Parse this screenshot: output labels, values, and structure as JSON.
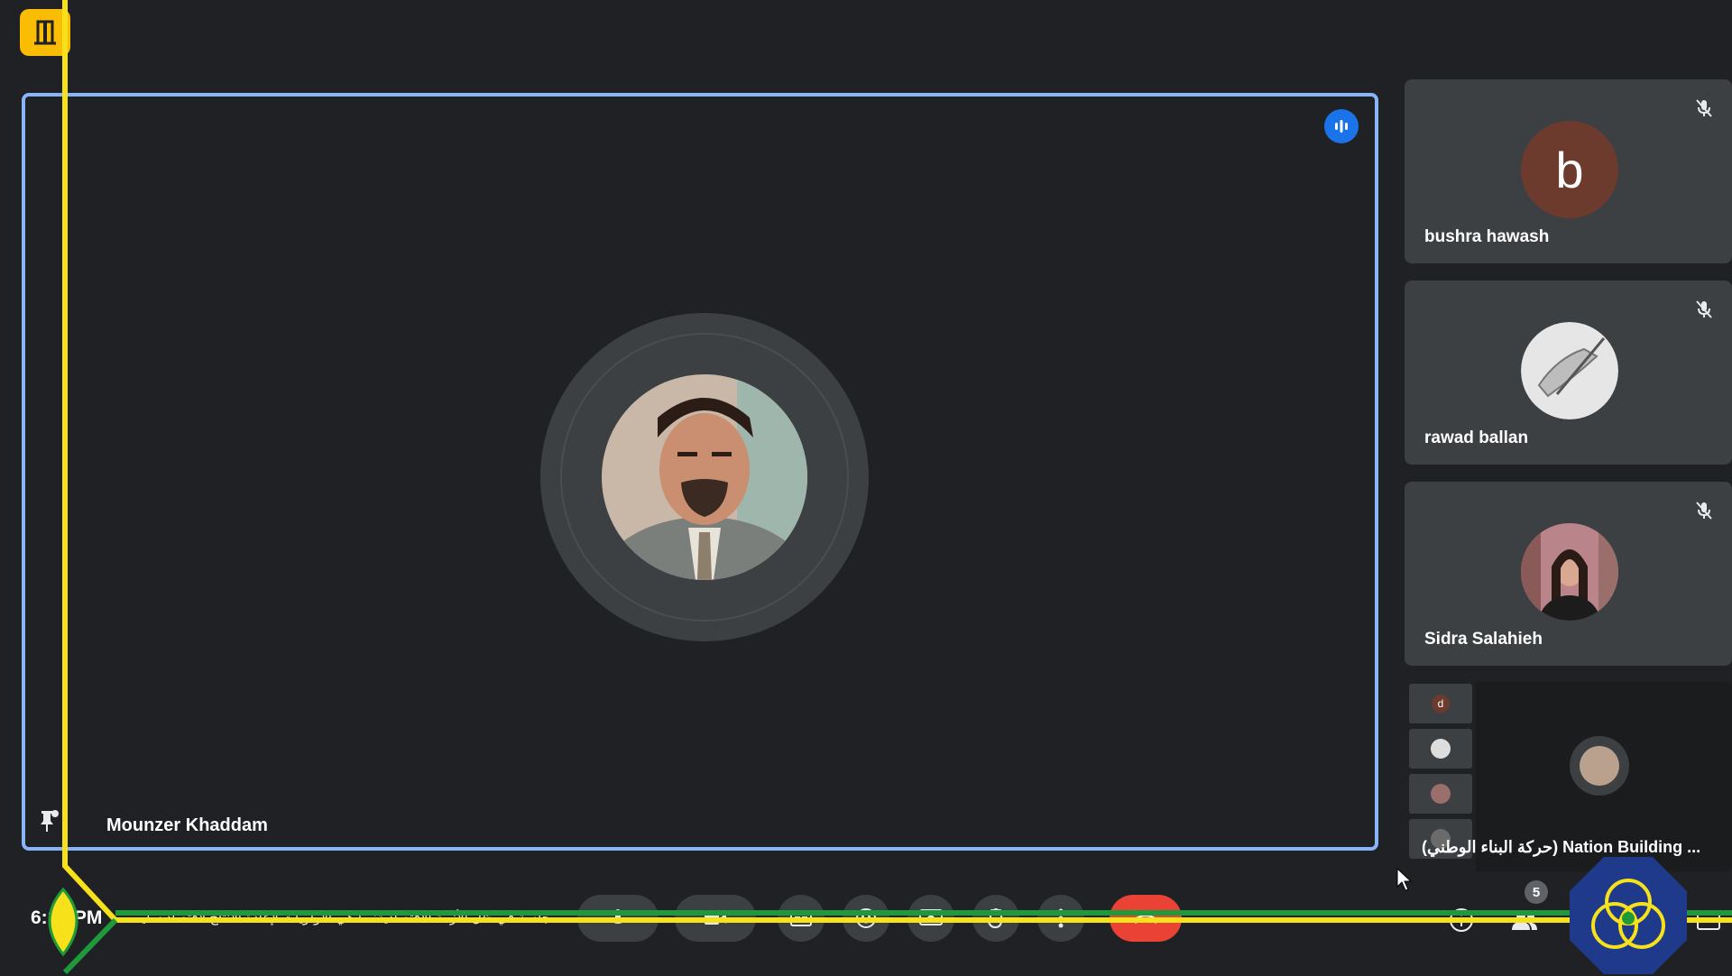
{
  "main_speaker": {
    "name": "Mounzer Khaddam"
  },
  "side_participants": [
    {
      "name": "bushra hawash",
      "avatar_letter": "b",
      "muted": true
    },
    {
      "name": "rawad ballan",
      "muted": true
    },
    {
      "name": "Sidra Salahieh",
      "muted": true
    }
  ],
  "mini_grid": {
    "label": "(حركة البناء الوطني) Nation Building ...",
    "thumb_letter": "d"
  },
  "footer": {
    "clock": "6:19 PM",
    "ticker": "جلسة في ظل الأزمة الاقتصادية: ما هي الاولويات لإعادة الانتاج لاقتصاد سليم في سوريا",
    "participant_count": "5"
  },
  "colors": {
    "active_border": "#8ab4f8",
    "end_call": "#ea4335",
    "speaking": "#1a73e8",
    "overlay_yellow": "#f6e11b",
    "overlay_green": "#1f9a3a",
    "logo_blue": "#1f3a8a"
  }
}
